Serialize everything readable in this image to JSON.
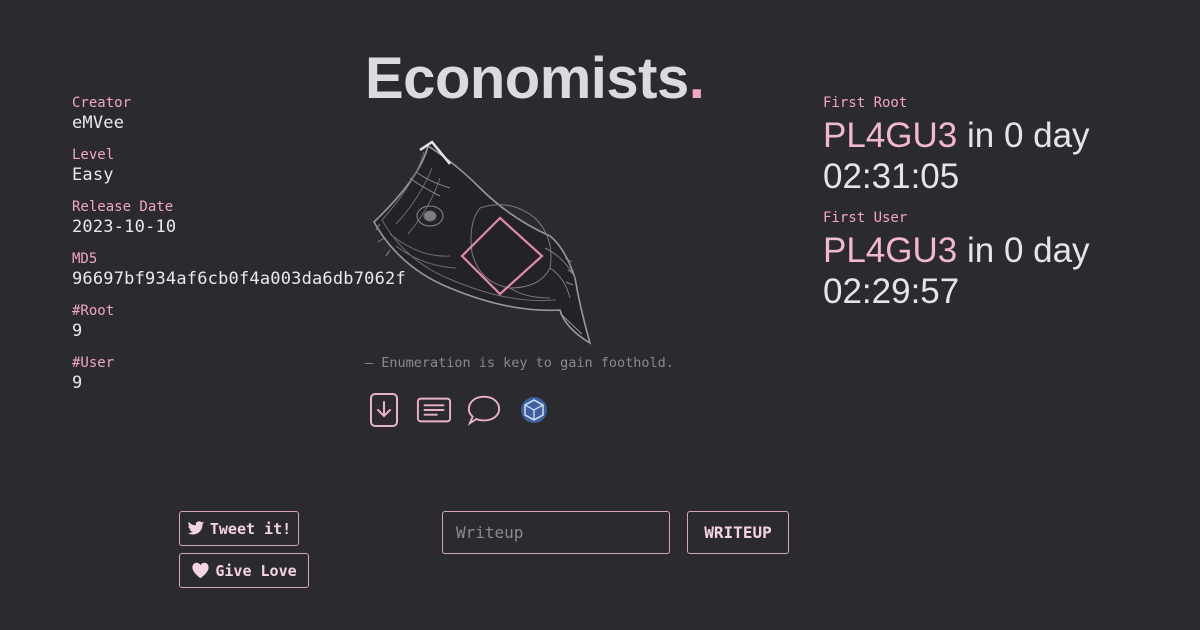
{
  "meta": {
    "creator_label": "Creator",
    "creator": "eMVee",
    "level_label": "Level",
    "level": "Easy",
    "release_label": "Release Date",
    "release": "2023-10-10",
    "md5_label": "MD5",
    "md5": "96697bf934af6cb0f4a003da6db7062f",
    "root_label": "#Root",
    "root": "9",
    "user_label": "#User",
    "user": "9"
  },
  "header": {
    "title": "Economists",
    "title_dot": "."
  },
  "quote": "— Enumeration is key to gain foothold.",
  "icons": [
    "download-icon",
    "document-lines-icon",
    "comment-bubble-icon",
    "cube-logo-icon"
  ],
  "first_root": {
    "label": "First Root",
    "user": "PL4GU3",
    "suffix": " in 0 day",
    "time": "02:31:05"
  },
  "first_user": {
    "label": "First User",
    "user": "PL4GU3",
    "suffix": " in 0 day",
    "time": "02:29:57"
  },
  "buttons": {
    "tweet": "Tweet it!",
    "love": "Give Love",
    "writeup": "WRITEUP"
  },
  "writeup_input": {
    "placeholder": "Writeup",
    "value": ""
  },
  "colors": {
    "background": "#2b2a2f",
    "accent": "#f2a6c4",
    "text": "#e6e4e6",
    "muted": "#8c8990"
  }
}
